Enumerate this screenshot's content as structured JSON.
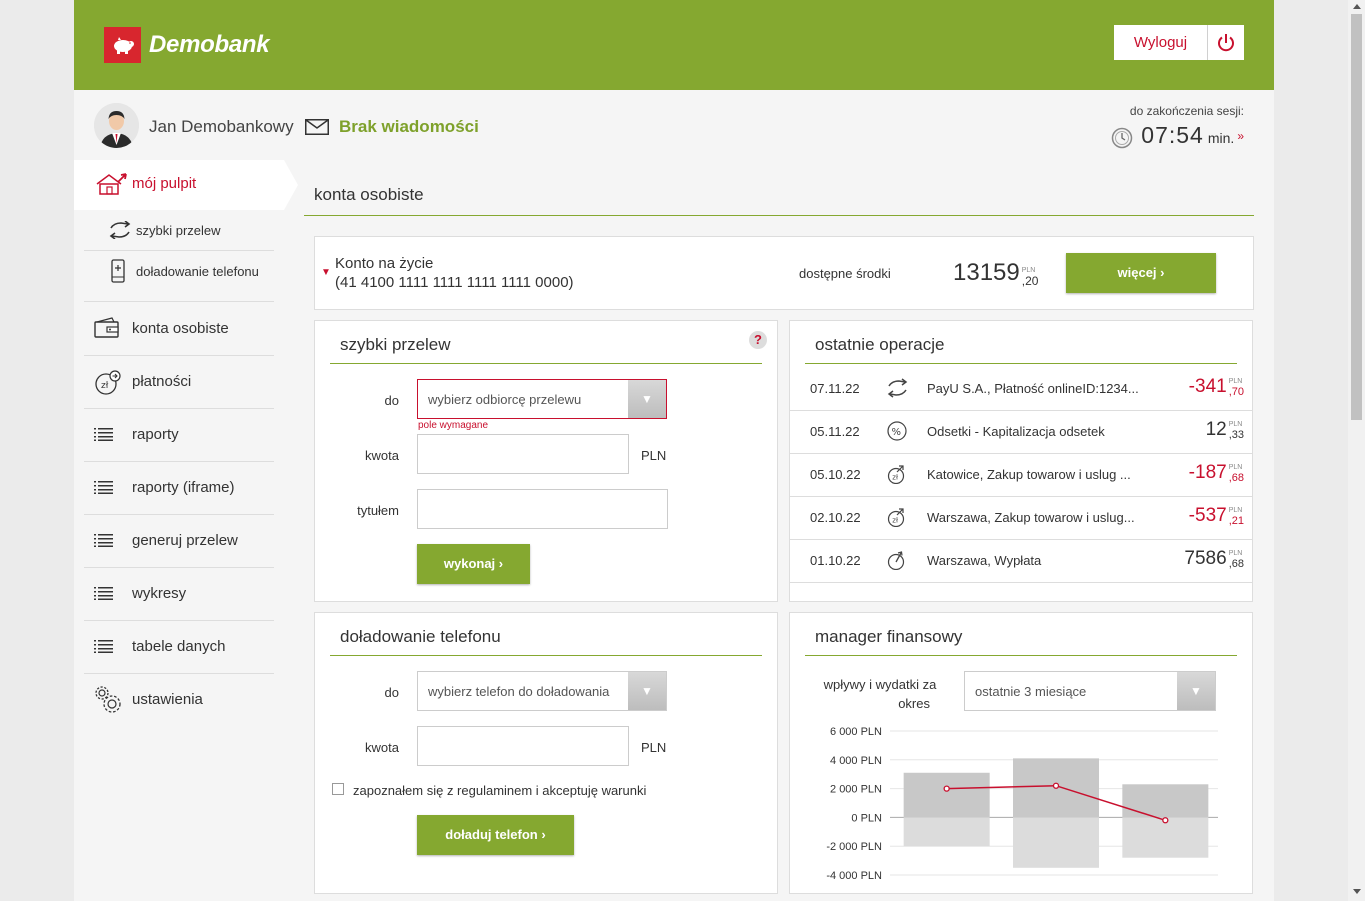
{
  "header": {
    "logo_text": "Demobank",
    "logout_label": "Wyloguj",
    "brand_color": "#85a830",
    "accent_color": "#c8102e"
  },
  "userbar": {
    "username": "Jan Demobankowy",
    "messages_label": "Brak wiadomości",
    "session_label": "do zakończenia sesji:",
    "session_time": "07:54",
    "session_unit": "min.",
    "session_more": "»"
  },
  "sidebar": {
    "active": "mój pulpit",
    "sub_items": [
      "szybki przelew",
      "doładowanie telefonu"
    ],
    "items": [
      "konta osobiste",
      "płatności",
      "raporty",
      "raporty (iframe)",
      "generuj przelew",
      "wykresy",
      "tabele danych",
      "ustawienia"
    ]
  },
  "accounts": {
    "section_title": "konta osobiste",
    "account_name": "Konto na życie",
    "account_number": "(41 4100 1111 1111 1111 1111 0000)",
    "available_label": "dostępne środki",
    "balance_int": "13159",
    "balance_dec": ",20",
    "currency": "PLN",
    "more_button": "więcej ›"
  },
  "quick_transfer": {
    "title": "szybki przelew",
    "help": "?",
    "to_label": "do",
    "to_placeholder": "wybierz odbiorcę przelewu",
    "required_error": "pole wymagane",
    "amount_label": "kwota",
    "amount_value": "",
    "currency": "PLN",
    "title_label": "tytułem",
    "title_value": "",
    "submit": "wykonaj ›"
  },
  "operations": {
    "title": "ostatnie operacje",
    "rows": [
      {
        "date": "07.11.22",
        "icon": "transfer-icon",
        "desc": "PayU S.A., Płatność onlineID:1234...",
        "int": "-341",
        "dec": ",70",
        "negative": true
      },
      {
        "date": "05.11.22",
        "icon": "percent-icon",
        "desc": "Odsetki - Kapitalizacja odsetek",
        "int": "12",
        "dec": ",33",
        "negative": false
      },
      {
        "date": "05.10.22",
        "icon": "payment-icon",
        "desc": "Katowice, Zakup towarow i uslug ...",
        "int": "-187",
        "dec": ",68",
        "negative": true
      },
      {
        "date": "02.10.22",
        "icon": "payment-icon",
        "desc": "Warszawa, Zakup towarow i uslug...",
        "int": "-537",
        "dec": ",21",
        "negative": true
      },
      {
        "date": "01.10.22",
        "icon": "withdrawal-icon",
        "desc": "Warszawa, Wypłata",
        "int": "7586",
        "dec": ",68",
        "negative": false
      }
    ],
    "currency": "PLN"
  },
  "topup": {
    "title": "doładowanie telefonu",
    "to_label": "do",
    "to_placeholder": "wybierz telefon do doładowania",
    "amount_label": "kwota",
    "amount_value": "",
    "currency": "PLN",
    "terms_label": "zapoznałem się z regulaminem i akceptuję warunki",
    "terms_checked": false,
    "submit": "doładuj telefon ›"
  },
  "finance": {
    "title": "manager finansowy",
    "period_label_1": "wpływy i wydatki za",
    "period_label_2": "okres",
    "period_value": "ostatnie 3 miesiące"
  },
  "chart_data": {
    "type": "bar",
    "categories": [
      "",
      "",
      ""
    ],
    "ylim": [
      -4000,
      6000
    ],
    "ytick_labels": [
      "6 000 PLN",
      "4 000 PLN",
      "2 000 PLN",
      "0 PLN",
      "-2 000 PLN",
      "-4 000 PLN"
    ],
    "ytick_values": [
      6000,
      4000,
      2000,
      0,
      -2000,
      -4000
    ],
    "series": [
      {
        "values": [
          3100,
          4100,
          2300
        ],
        "color": "#c8c8c8"
      },
      {
        "values": [
          -2000,
          -3500,
          -2800
        ],
        "color": "#dcdcdc"
      },
      {
        "values": [
          2000,
          2200,
          -200
        ],
        "color": "#c8102e"
      }
    ],
    "grid": true
  }
}
